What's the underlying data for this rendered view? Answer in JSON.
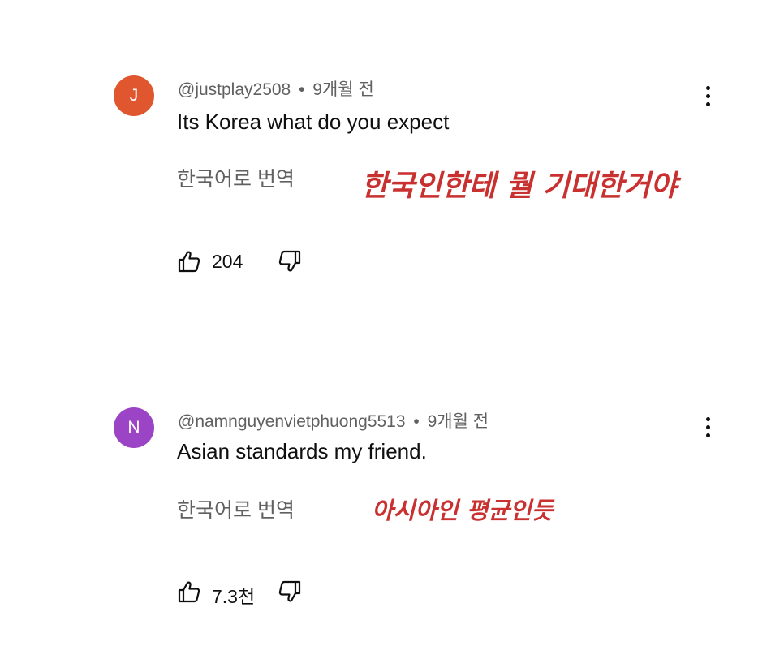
{
  "comments": [
    {
      "avatar_letter": "J",
      "avatar_color": "#e0562e",
      "handle": "@justplay2508",
      "separator": "•",
      "time": "9개월 전",
      "text": "Its Korea what do you expect",
      "translate_label": "한국어로 번역",
      "overlay_text": "한국인한테 뭘 기대한거야",
      "likes": "204",
      "menu_icon": "vertical-dots-icon",
      "like_icon": "thumbs-up-icon",
      "dislike_icon": "thumbs-down-icon"
    },
    {
      "avatar_letter": "N",
      "avatar_color": "#9c44c6",
      "handle": "@namnguyenvietphuong5513",
      "separator": "•",
      "time": "9개월 전",
      "text": "Asian standards my friend.",
      "translate_label": "한국어로 번역",
      "overlay_text": "아시아인 평균인듯",
      "likes": "7.3천",
      "menu_icon": "vertical-dots-icon",
      "like_icon": "thumbs-up-icon",
      "dislike_icon": "thumbs-down-icon"
    }
  ],
  "colors": {
    "text_primary": "#0f0f0f",
    "text_secondary": "#606060",
    "overlay_red": "#c8312f"
  }
}
